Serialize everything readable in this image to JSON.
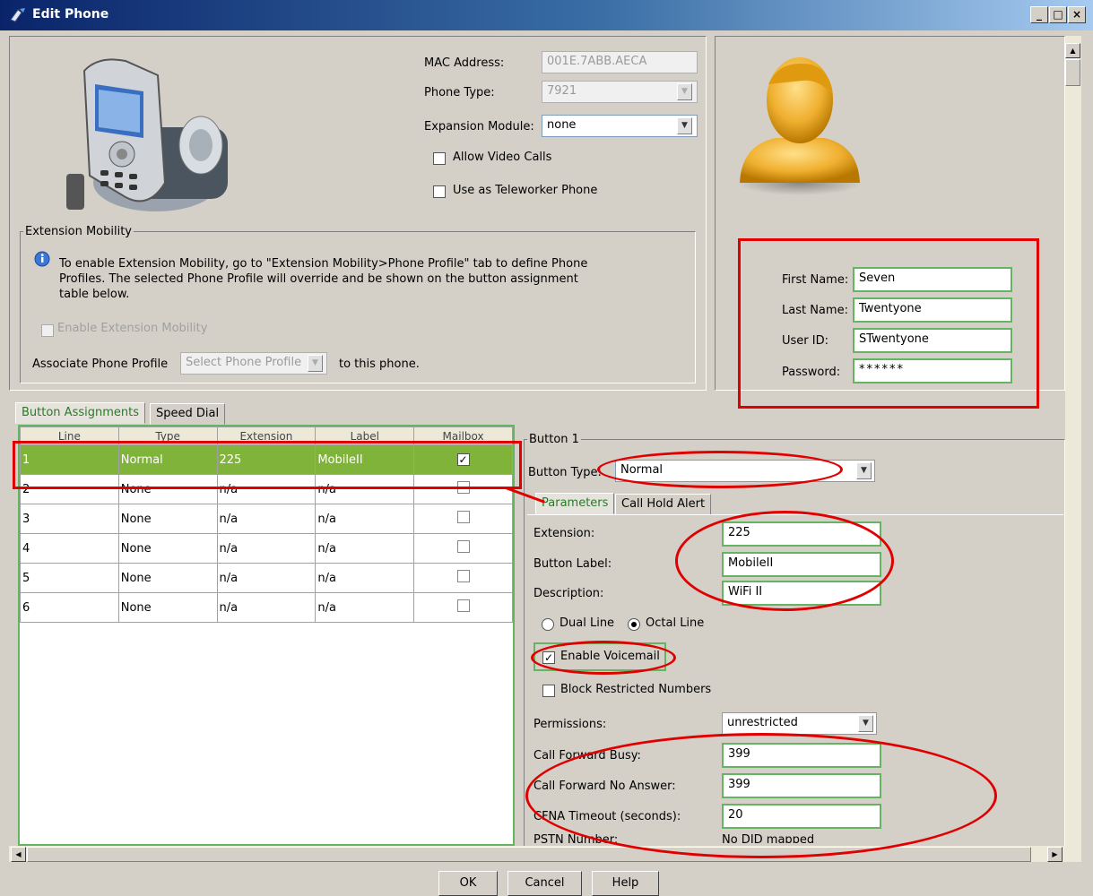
{
  "window": {
    "title": "Edit Phone",
    "minimize": "_",
    "maximize": "□",
    "close": "×"
  },
  "device": {
    "mac_label": "MAC Address:",
    "mac_value": "001E.7ABB.AECA",
    "phone_type_label": "Phone Type:",
    "phone_type_value": "7921",
    "expansion_label": "Expansion Module:",
    "expansion_value": "none",
    "allow_video_label": "Allow Video Calls",
    "teleworker_label": "Use as Teleworker Phone"
  },
  "mobility": {
    "legend": "Extension Mobility",
    "info_text": "To enable Extension Mobility, go to \"Extension Mobility>Phone Profile\" tab to define Phone Profiles. The selected Phone Profile will override and be shown on the button assignment table below.",
    "enable_label": "Enable Extension Mobility",
    "associate_label": "Associate Phone Profile",
    "profile_placeholder": "Select Phone Profile",
    "to_this_phone": "to this phone."
  },
  "user": {
    "first_label": "First Name:",
    "first_value": "Seven",
    "last_label": "Last Name:",
    "last_value": "Twentyone",
    "userid_label": "User ID:",
    "userid_value": "STwentyone",
    "password_label": "Password:",
    "password_value": "******"
  },
  "tabs": {
    "button_assignments": "Button Assignments",
    "speed_dial": "Speed Dial"
  },
  "table": {
    "headers": [
      "Line",
      "Type",
      "Extension",
      "Label",
      "Mailbox"
    ],
    "rows": [
      {
        "line": "1",
        "type": "Normal",
        "ext": "225",
        "label": "MobileII",
        "mailbox": true
      },
      {
        "line": "2",
        "type": "None",
        "ext": "n/a",
        "label": "n/a",
        "mailbox": false
      },
      {
        "line": "3",
        "type": "None",
        "ext": "n/a",
        "label": "n/a",
        "mailbox": false
      },
      {
        "line": "4",
        "type": "None",
        "ext": "n/a",
        "label": "n/a",
        "mailbox": false
      },
      {
        "line": "5",
        "type": "None",
        "ext": "n/a",
        "label": "n/a",
        "mailbox": false
      },
      {
        "line": "6",
        "type": "None",
        "ext": "n/a",
        "label": "n/a",
        "mailbox": false
      }
    ]
  },
  "button": {
    "legend": "Button 1",
    "type_label": "Button Type:",
    "type_value": "Normal",
    "tab_parameters": "Parameters",
    "tab_hold": "Call Hold Alert",
    "ext_label": "Extension:",
    "ext_value": "225",
    "btn_label_label": "Button Label:",
    "btn_label_value": "MobileII",
    "desc_label": "Description:",
    "desc_value": "WiFi II",
    "dual_line": "Dual Line",
    "octal_line": "Octal Line",
    "enable_vm": "Enable Voicemail",
    "block_restricted": "Block Restricted Numbers",
    "perm_label": "Permissions:",
    "perm_value": "unrestricted",
    "cfb_label": "Call Forward Busy:",
    "cfb_value": "399",
    "cfna_label": "Call Forward No Answer:",
    "cfna_value": "399",
    "cfna_timeout_label": "CFNA Timeout (seconds):",
    "cfna_timeout_value": "20",
    "pstn_label": "PSTN Number:",
    "pstn_value": "No DID mapped"
  },
  "footer": {
    "ok": "OK",
    "cancel": "Cancel",
    "help": "Help"
  },
  "colors": {
    "selection": "#7fb33a",
    "annotation": "#e00000",
    "titlebar": "#0a246a"
  }
}
